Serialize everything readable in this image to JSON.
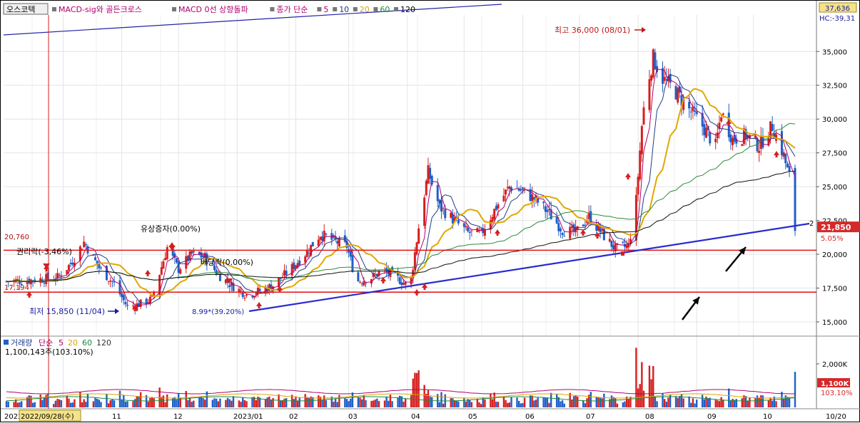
{
  "header": {
    "stock_name": "오스코텍",
    "indicators": [
      {
        "text": "MACD-sig와 골든크로스",
        "color": "#b0006e"
      },
      {
        "text": "MACD 0선 상향돌파",
        "color": "#b0006e"
      },
      {
        "text": "종가 단순",
        "color": "#b0006e"
      },
      {
        "text": "5",
        "color": "#b0006e"
      },
      {
        "text": "10",
        "color": "#1f3c88"
      },
      {
        "text": "20",
        "color": "#d9a300"
      },
      {
        "text": "60",
        "color": "#1d8a3a"
      },
      {
        "text": "120",
        "color": "#000000"
      }
    ],
    "top_right_value": "37,636",
    "hc_text": "HC:-39,31"
  },
  "chart_data": {
    "type": "candlestick",
    "ylim": [
      14000,
      37700
    ],
    "y_ticks": [
      15000,
      17500,
      20000,
      22500,
      25000,
      27500,
      30000,
      32500,
      35000
    ],
    "y_tick_labels": [
      "15,000",
      "17,500",
      "20,000",
      "22,500",
      "25,000",
      "27,500",
      "30,000",
      "32,500",
      "35,000"
    ],
    "x_ticks": [
      "2022",
      "2022/09/28(수)",
      "11",
      "12",
      "2023/01",
      "02",
      "03",
      "04",
      "05",
      "06",
      "07",
      "08",
      "09",
      "10",
      "10/20"
    ],
    "price_anchors": [
      [
        "2022/09/01",
        18000
      ],
      [
        "2022/09/15",
        18100
      ],
      [
        "2022/09/28",
        18300
      ],
      [
        "2022/10/05",
        19300
      ],
      [
        "2022/10/12",
        20900
      ],
      [
        "2022/10/20",
        19000
      ],
      [
        "2022/10/28",
        17800
      ],
      [
        "2022/11/04",
        16100
      ],
      [
        "2022/11/10",
        16300
      ],
      [
        "2022/11/17",
        16700
      ],
      [
        "2022/11/25",
        20500
      ],
      [
        "2022/12/01",
        18900
      ],
      [
        "2022/12/08",
        20000
      ],
      [
        "2022/12/15",
        19800
      ],
      [
        "2022/12/22",
        18500
      ],
      [
        "2022/12/29",
        17700
      ],
      [
        "2023/01/06",
        17000
      ],
      [
        "2023/01/13",
        17300
      ],
      [
        "2023/01/20",
        17700
      ],
      [
        "2023/01/30",
        19000
      ],
      [
        "2023/02/07",
        20200
      ],
      [
        "2023/02/14",
        21500
      ],
      [
        "2023/02/21",
        21000
      ],
      [
        "2023/02/28",
        20600
      ],
      [
        "2023/03/05",
        18000
      ],
      [
        "2023/03/12",
        18200
      ],
      [
        "2023/03/19",
        18800
      ],
      [
        "2023/03/26",
        18300
      ],
      [
        "2023/03/31",
        17800
      ],
      [
        "2023/04/03",
        18200
      ],
      [
        "2023/04/07",
        22000
      ],
      [
        "2023/04/12",
        26100
      ],
      [
        "2023/04/18",
        23500
      ],
      [
        "2023/04/25",
        22600
      ],
      [
        "2023/05/03",
        21600
      ],
      [
        "2023/05/10",
        21500
      ],
      [
        "2023/05/18",
        23500
      ],
      [
        "2023/05/25",
        25000
      ],
      [
        "2023/06/01",
        24700
      ],
      [
        "2023/06/08",
        24000
      ],
      [
        "2023/06/15",
        23000
      ],
      [
        "2023/06/22",
        21800
      ],
      [
        "2023/06/29",
        21600
      ],
      [
        "2023/07/06",
        22800
      ],
      [
        "2023/07/13",
        21500
      ],
      [
        "2023/07/20",
        20400
      ],
      [
        "2023/07/27",
        20600
      ],
      [
        "2023/07/31",
        24000
      ],
      [
        "2023/08/03",
        29500
      ],
      [
        "2023/08/05",
        32000
      ],
      [
        "2023/08/09",
        34500
      ],
      [
        "2023/08/14",
        33000
      ],
      [
        "2023/08/21",
        32000
      ],
      [
        "2023/08/28",
        30700
      ],
      [
        "2023/09/04",
        29500
      ],
      [
        "2023/09/11",
        28000
      ],
      [
        "2023/09/14",
        30500
      ],
      [
        "2023/09/20",
        28500
      ],
      [
        "2023/09/27",
        28800
      ],
      [
        "2023/10/04",
        28000
      ],
      [
        "2023/10/11",
        29500
      ],
      [
        "2023/10/17",
        27300
      ],
      [
        "2023/10/19",
        26200
      ],
      [
        "2023/10/20",
        25800
      ],
      [
        "2023/10/23",
        21850
      ]
    ],
    "current_price": "21,850",
    "current_change": "5.05%",
    "annotations": {
      "high": "최고 36,000 (08/01)",
      "low": "최저 15,850 (11/04)",
      "ex_rights": "권리락(-3,46%)",
      "rights_offering": "유상증자(0.00%)",
      "ex_dividend": "배당락(0.00%)",
      "drop": "8.99*(39.20%)",
      "left_level_1": "20,760",
      "left_level_2": "17,194",
      "trend_tag": "2"
    },
    "support_lines": [
      20300,
      17200
    ],
    "volume": {
      "legend": [
        {
          "text": "거래량",
          "color": "#1f3c88"
        },
        {
          "text": "단순",
          "color": "#b0006e"
        },
        {
          "text": "5",
          "color": "#b0006e"
        },
        {
          "text": "20",
          "color": "#d9a300"
        },
        {
          "text": "60",
          "color": "#1d8a3a"
        },
        {
          "text": "120",
          "color": "#333333"
        }
      ],
      "info": "1,100,143주(103.10%)",
      "y_tick_label": "2,000K",
      "current_label": "1,100K",
      "current_pct": "103.10%"
    }
  }
}
